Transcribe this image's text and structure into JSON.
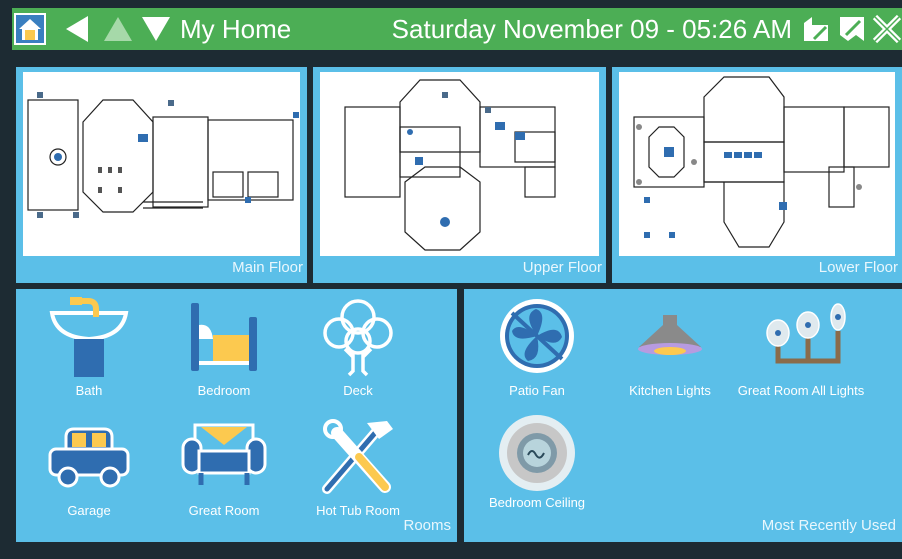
{
  "header": {
    "title": "My Home",
    "datetime": "Saturday November 09 - 05:26 AM"
  },
  "floors": [
    {
      "label": "Main Floor"
    },
    {
      "label": "Upper Floor"
    },
    {
      "label": "Lower Floor"
    }
  ],
  "rooms": {
    "caption": "Rooms",
    "items": [
      {
        "label": "Bath",
        "icon": "sink-icon"
      },
      {
        "label": "Bedroom",
        "icon": "bed-icon"
      },
      {
        "label": "Deck",
        "icon": "tree-icon"
      },
      {
        "label": "Garage",
        "icon": "car-icon"
      },
      {
        "label": "Great Room",
        "icon": "armchair-icon"
      },
      {
        "label": "Hot Tub Room",
        "icon": "tools-icon"
      }
    ]
  },
  "recent": {
    "caption": "Most Recently Used",
    "items": [
      {
        "label": "Patio Fan",
        "icon": "fan-icon"
      },
      {
        "label": "Kitchen Lights",
        "icon": "ceiling-light-icon"
      },
      {
        "label": "Great Room All Lights",
        "icon": "bulbs-icon"
      },
      {
        "label": "Bedroom Ceiling",
        "icon": "dome-light-icon"
      }
    ]
  },
  "colors": {
    "header_green": "#4cae55",
    "panel_blue": "#5bbfe8",
    "background": "#1d2b33",
    "icon_blue": "#2f6db0",
    "icon_yellow": "#fcc94f"
  }
}
